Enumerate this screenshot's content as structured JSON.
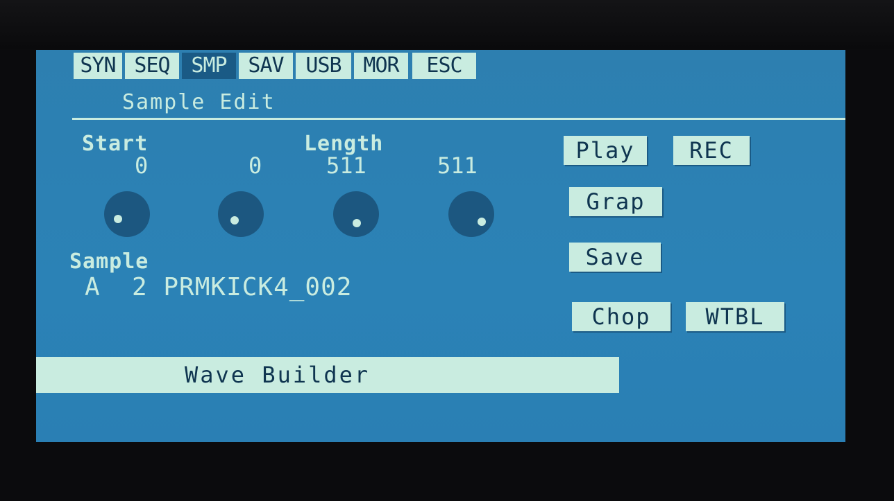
{
  "menu": {
    "items": [
      {
        "label": "SYN"
      },
      {
        "label": "SEQ"
      },
      {
        "label": "SMP"
      },
      {
        "label": "SAV"
      },
      {
        "label": "USB"
      },
      {
        "label": "MOR"
      },
      {
        "label": "ESC"
      }
    ],
    "active": "SMP"
  },
  "page_title": "Sample Edit",
  "params": {
    "start_label": "Start",
    "length_label": "Length",
    "values": [
      "0",
      "0",
      "511",
      "511"
    ]
  },
  "sample": {
    "label": "Sample",
    "id": "A  2 PRMKICK4_002"
  },
  "buttons": {
    "play": "Play",
    "rec": "REC",
    "grap": "Grap",
    "save": "Save",
    "chop": "Chop",
    "wtbl": "WTBL"
  },
  "banner": "Wave Builder",
  "colors": {
    "screen_bg": "#2b82b6",
    "foreground": "#c9ece0",
    "dark_text": "#0f3550",
    "knob": "#1c5780"
  }
}
